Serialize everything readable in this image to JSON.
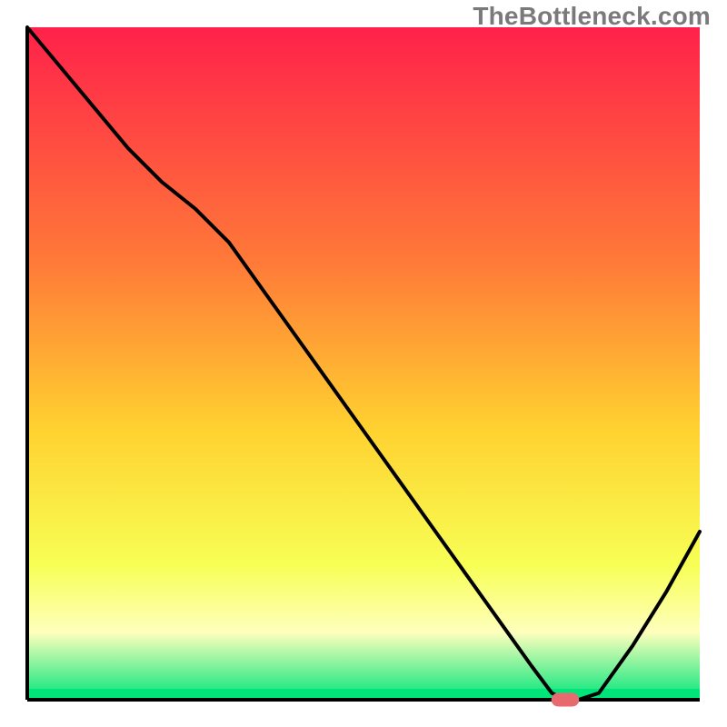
{
  "watermark": "TheBottleneck.com",
  "colors": {
    "gradient_top": "#ff214a",
    "gradient_mid_upper": "#ff7a38",
    "gradient_mid": "#ffd230",
    "gradient_mid_lower": "#f7ff55",
    "gradient_band": "#ffffbd",
    "gradient_green": "#00e57a",
    "axis": "#000000",
    "curve": "#000000",
    "marker_fill": "#e76a6f",
    "marker_stroke": "#e76a6f"
  },
  "chart_data": {
    "type": "line",
    "title": "",
    "xlabel": "",
    "ylabel": "",
    "xlim": [
      0,
      100
    ],
    "ylim": [
      0,
      100
    ],
    "series": [
      {
        "name": "bottleneck-curve",
        "x": [
          0,
          5,
          10,
          15,
          20,
          25,
          30,
          35,
          40,
          45,
          50,
          55,
          60,
          65,
          70,
          75,
          78,
          80,
          82,
          85,
          90,
          95,
          100
        ],
        "values": [
          100,
          94,
          88,
          82,
          77,
          73,
          68,
          61,
          54,
          47,
          40,
          33,
          26,
          19,
          12,
          5,
          1,
          0,
          0,
          1,
          8,
          16,
          25
        ]
      }
    ],
    "marker": {
      "name": "optimal-range",
      "x_start": 78,
      "x_end": 82,
      "y": 0
    }
  }
}
